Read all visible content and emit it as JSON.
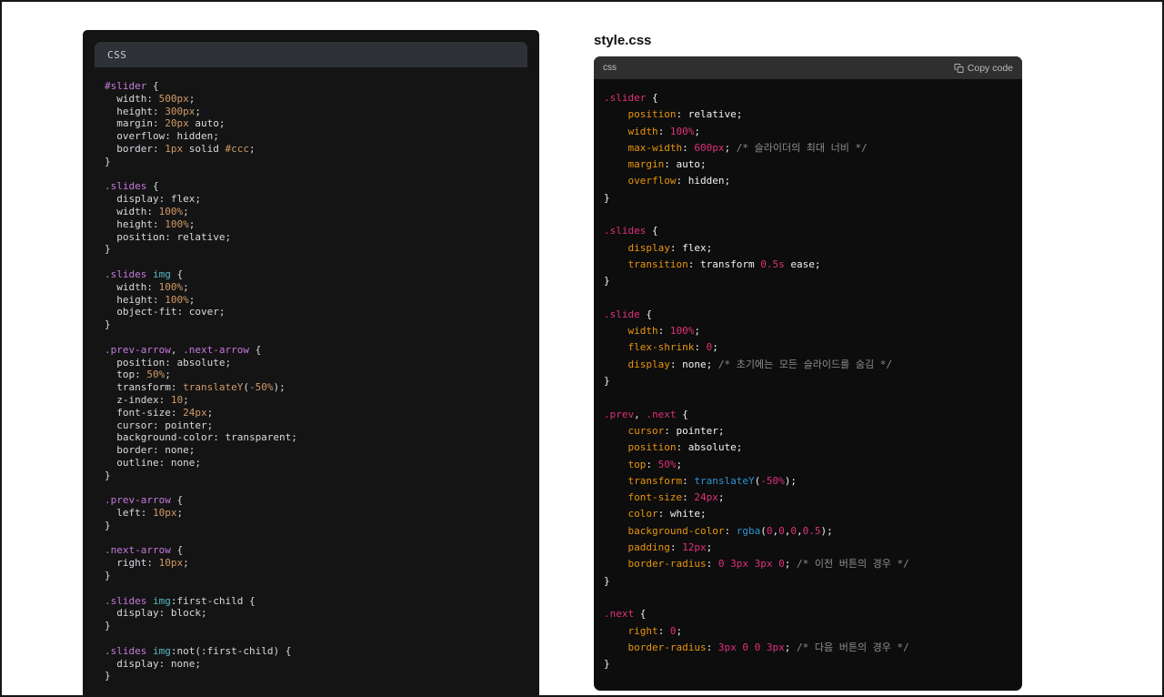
{
  "page": {
    "background": "#ffffff",
    "frame_border": "#161616"
  },
  "left_panel": {
    "header_label": "CSS",
    "colors": {
      "panel_bg": "#141414",
      "header_bg": "#2e3135",
      "header_text": "#cbcfd4"
    },
    "palette": {
      "sel": "#c678dd",
      "tag": "#56b6c2",
      "num": "#d19a66",
      "pln": "#d7dae0"
    },
    "code_lines": [
      [
        [
          "sel",
          "#slider"
        ],
        [
          "pln",
          " {"
        ]
      ],
      [
        [
          "pln",
          "  width: "
        ],
        [
          "num",
          "500px"
        ],
        [
          "pln",
          ";"
        ]
      ],
      [
        [
          "pln",
          "  height: "
        ],
        [
          "num",
          "300px"
        ],
        [
          "pln",
          ";"
        ]
      ],
      [
        [
          "pln",
          "  margin: "
        ],
        [
          "num",
          "20px"
        ],
        [
          "pln",
          " auto;"
        ]
      ],
      [
        [
          "pln",
          "  overflow: hidden;"
        ]
      ],
      [
        [
          "pln",
          "  border: "
        ],
        [
          "num",
          "1px"
        ],
        [
          "pln",
          " solid "
        ],
        [
          "num",
          "#ccc"
        ],
        [
          "pln",
          ";"
        ]
      ],
      [
        [
          "pln",
          "}"
        ]
      ],
      [],
      [
        [
          "sel",
          ".slides"
        ],
        [
          "pln",
          " {"
        ]
      ],
      [
        [
          "pln",
          "  display: flex;"
        ]
      ],
      [
        [
          "pln",
          "  width: "
        ],
        [
          "num",
          "100%"
        ],
        [
          "pln",
          ";"
        ]
      ],
      [
        [
          "pln",
          "  height: "
        ],
        [
          "num",
          "100%"
        ],
        [
          "pln",
          ";"
        ]
      ],
      [
        [
          "pln",
          "  position: relative;"
        ]
      ],
      [
        [
          "pln",
          "}"
        ]
      ],
      [],
      [
        [
          "sel",
          ".slides"
        ],
        [
          "pln",
          " "
        ],
        [
          "tag",
          "img"
        ],
        [
          "pln",
          " {"
        ]
      ],
      [
        [
          "pln",
          "  width: "
        ],
        [
          "num",
          "100%"
        ],
        [
          "pln",
          ";"
        ]
      ],
      [
        [
          "pln",
          "  height: "
        ],
        [
          "num",
          "100%"
        ],
        [
          "pln",
          ";"
        ]
      ],
      [
        [
          "pln",
          "  object-fit: cover;"
        ]
      ],
      [
        [
          "pln",
          "}"
        ]
      ],
      [],
      [
        [
          "sel",
          ".prev-arrow"
        ],
        [
          "pln",
          ", "
        ],
        [
          "sel",
          ".next-arrow"
        ],
        [
          "pln",
          " {"
        ]
      ],
      [
        [
          "pln",
          "  position: absolute;"
        ]
      ],
      [
        [
          "pln",
          "  top: "
        ],
        [
          "num",
          "50%"
        ],
        [
          "pln",
          ";"
        ]
      ],
      [
        [
          "pln",
          "  transform: "
        ],
        [
          "num",
          "translateY"
        ],
        [
          "pln",
          "("
        ],
        [
          "num",
          "-50%"
        ],
        [
          "pln",
          ");"
        ]
      ],
      [
        [
          "pln",
          "  z-index: "
        ],
        [
          "num",
          "10"
        ],
        [
          "pln",
          ";"
        ]
      ],
      [
        [
          "pln",
          "  font-size: "
        ],
        [
          "num",
          "24px"
        ],
        [
          "pln",
          ";"
        ]
      ],
      [
        [
          "pln",
          "  cursor: pointer;"
        ]
      ],
      [
        [
          "pln",
          "  background-color: transparent;"
        ]
      ],
      [
        [
          "pln",
          "  border: none;"
        ]
      ],
      [
        [
          "pln",
          "  outline: none;"
        ]
      ],
      [
        [
          "pln",
          "}"
        ]
      ],
      [],
      [
        [
          "sel",
          ".prev-arrow"
        ],
        [
          "pln",
          " {"
        ]
      ],
      [
        [
          "pln",
          "  left: "
        ],
        [
          "num",
          "10px"
        ],
        [
          "pln",
          ";"
        ]
      ],
      [
        [
          "pln",
          "}"
        ]
      ],
      [],
      [
        [
          "sel",
          ".next-arrow"
        ],
        [
          "pln",
          " {"
        ]
      ],
      [
        [
          "pln",
          "  right: "
        ],
        [
          "num",
          "10px"
        ],
        [
          "pln",
          ";"
        ]
      ],
      [
        [
          "pln",
          "}"
        ]
      ],
      [],
      [
        [
          "sel",
          ".slides"
        ],
        [
          "pln",
          " "
        ],
        [
          "tag",
          "img"
        ],
        [
          "pln",
          ":first-child {"
        ]
      ],
      [
        [
          "pln",
          "  display: block;"
        ]
      ],
      [
        [
          "pln",
          "}"
        ]
      ],
      [],
      [
        [
          "sel",
          ".slides"
        ],
        [
          "pln",
          " "
        ],
        [
          "tag",
          "img"
        ],
        [
          "pln",
          ":not(:first-child) {"
        ]
      ],
      [
        [
          "pln",
          "  display: none;"
        ]
      ],
      [
        [
          "pln",
          "}"
        ]
      ]
    ]
  },
  "right_panel": {
    "title": "style.css",
    "header_language": "css",
    "copy_button_label": "Copy code",
    "colors": {
      "panel_bg": "#0d0d0d",
      "header_bg": "#2f2f2f",
      "header_text": "#c0c0c0"
    },
    "palette": {
      "sel": "#df3079",
      "prop": "#e9950c",
      "num": "#df3079",
      "fn": "#2e95d3",
      "com": "#8e8e8e",
      "pln": "#f2f2f3"
    },
    "code_lines": [
      [
        [
          "sel",
          ".slider"
        ],
        [
          "pln",
          " {"
        ]
      ],
      [
        [
          "prop",
          "    position"
        ],
        [
          "pln",
          ": relative;"
        ]
      ],
      [
        [
          "prop",
          "    width"
        ],
        [
          "pln",
          ": "
        ],
        [
          "num",
          "100%"
        ],
        [
          "pln",
          ";"
        ]
      ],
      [
        [
          "prop",
          "    max-width"
        ],
        [
          "pln",
          ": "
        ],
        [
          "num",
          "600px"
        ],
        [
          "pln",
          "; "
        ],
        [
          "com",
          "/* 슬라이더의 최대 너비 */"
        ]
      ],
      [
        [
          "prop",
          "    margin"
        ],
        [
          "pln",
          ": auto;"
        ]
      ],
      [
        [
          "prop",
          "    overflow"
        ],
        [
          "pln",
          ": hidden;"
        ]
      ],
      [
        [
          "pln",
          "}"
        ]
      ],
      [],
      [
        [
          "sel",
          ".slides"
        ],
        [
          "pln",
          " {"
        ]
      ],
      [
        [
          "prop",
          "    display"
        ],
        [
          "pln",
          ": flex;"
        ]
      ],
      [
        [
          "prop",
          "    transition"
        ],
        [
          "pln",
          ": transform "
        ],
        [
          "num",
          "0.5s"
        ],
        [
          "pln",
          " ease;"
        ]
      ],
      [
        [
          "pln",
          "}"
        ]
      ],
      [],
      [
        [
          "sel",
          ".slide"
        ],
        [
          "pln",
          " {"
        ]
      ],
      [
        [
          "prop",
          "    width"
        ],
        [
          "pln",
          ": "
        ],
        [
          "num",
          "100%"
        ],
        [
          "pln",
          ";"
        ]
      ],
      [
        [
          "prop",
          "    flex-shrink"
        ],
        [
          "pln",
          ": "
        ],
        [
          "num",
          "0"
        ],
        [
          "pln",
          ";"
        ]
      ],
      [
        [
          "prop",
          "    display"
        ],
        [
          "pln",
          ": none; "
        ],
        [
          "com",
          "/* 초기에는 모든 슬라이드를 숨김 */"
        ]
      ],
      [
        [
          "pln",
          "}"
        ]
      ],
      [],
      [
        [
          "sel",
          ".prev"
        ],
        [
          "pln",
          ", "
        ],
        [
          "sel",
          ".next"
        ],
        [
          "pln",
          " {"
        ]
      ],
      [
        [
          "prop",
          "    cursor"
        ],
        [
          "pln",
          ": pointer;"
        ]
      ],
      [
        [
          "prop",
          "    position"
        ],
        [
          "pln",
          ": absolute;"
        ]
      ],
      [
        [
          "prop",
          "    top"
        ],
        [
          "pln",
          ": "
        ],
        [
          "num",
          "50%"
        ],
        [
          "pln",
          ";"
        ]
      ],
      [
        [
          "prop",
          "    transform"
        ],
        [
          "pln",
          ": "
        ],
        [
          "fn",
          "translateY"
        ],
        [
          "pln",
          "("
        ],
        [
          "num",
          "-50%"
        ],
        [
          "pln",
          ");"
        ]
      ],
      [
        [
          "prop",
          "    font-size"
        ],
        [
          "pln",
          ": "
        ],
        [
          "num",
          "24px"
        ],
        [
          "pln",
          ";"
        ]
      ],
      [
        [
          "prop",
          "    color"
        ],
        [
          "pln",
          ": white;"
        ]
      ],
      [
        [
          "prop",
          "    background-color"
        ],
        [
          "pln",
          ": "
        ],
        [
          "fn",
          "rgba"
        ],
        [
          "pln",
          "("
        ],
        [
          "num",
          "0"
        ],
        [
          "pln",
          ","
        ],
        [
          "num",
          "0"
        ],
        [
          "pln",
          ","
        ],
        [
          "num",
          "0"
        ],
        [
          "pln",
          ","
        ],
        [
          "num",
          "0.5"
        ],
        [
          "pln",
          ");"
        ]
      ],
      [
        [
          "prop",
          "    padding"
        ],
        [
          "pln",
          ": "
        ],
        [
          "num",
          "12px"
        ],
        [
          "pln",
          ";"
        ]
      ],
      [
        [
          "prop",
          "    border-radius"
        ],
        [
          "pln",
          ": "
        ],
        [
          "num",
          "0"
        ],
        [
          "pln",
          " "
        ],
        [
          "num",
          "3px"
        ],
        [
          "pln",
          " "
        ],
        [
          "num",
          "3px"
        ],
        [
          "pln",
          " "
        ],
        [
          "num",
          "0"
        ],
        [
          "pln",
          "; "
        ],
        [
          "com",
          "/* 이전 버튼의 경우 */"
        ]
      ],
      [
        [
          "pln",
          "}"
        ]
      ],
      [],
      [
        [
          "sel",
          ".next"
        ],
        [
          "pln",
          " {"
        ]
      ],
      [
        [
          "prop",
          "    right"
        ],
        [
          "pln",
          ": "
        ],
        [
          "num",
          "0"
        ],
        [
          "pln",
          ";"
        ]
      ],
      [
        [
          "prop",
          "    border-radius"
        ],
        [
          "pln",
          ": "
        ],
        [
          "num",
          "3px"
        ],
        [
          "pln",
          " "
        ],
        [
          "num",
          "0"
        ],
        [
          "pln",
          " "
        ],
        [
          "num",
          "0"
        ],
        [
          "pln",
          " "
        ],
        [
          "num",
          "3px"
        ],
        [
          "pln",
          "; "
        ],
        [
          "com",
          "/* 다음 버튼의 경우 */"
        ]
      ],
      [
        [
          "pln",
          "}"
        ]
      ]
    ]
  }
}
